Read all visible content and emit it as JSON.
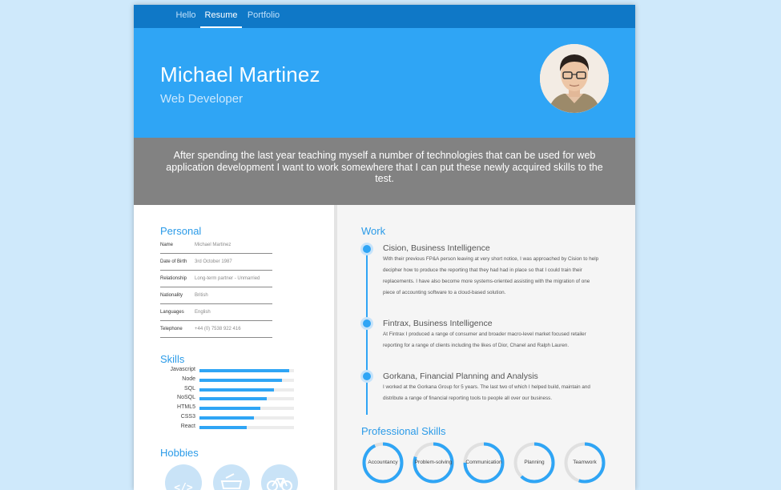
{
  "nav": {
    "items": [
      "Hello",
      "Resume",
      "Portfolio"
    ],
    "active": "Resume"
  },
  "header": {
    "name": "Michael Martinez",
    "role": "Web Developer"
  },
  "intro": "After spending the last year teaching myself a number of technologies that can be used for web application development I want to work somewhere that I can put these newly acquired skills to the test.",
  "personal": {
    "title": "Personal",
    "rows": [
      {
        "label": "Name",
        "value": "Michael Martinez"
      },
      {
        "label": "Date of Birth",
        "value": "3rd October 1987"
      },
      {
        "label": "Relationship",
        "value": "Long-term partner - Unmarried"
      },
      {
        "label": "Nationality",
        "value": "British"
      },
      {
        "label": "Languages",
        "value": "English"
      },
      {
        "label": "Telephone",
        "value": "+44 (0) 7538 922 416"
      }
    ]
  },
  "skills": {
    "title": "Skills",
    "items": [
      {
        "name": "Javascript",
        "level": 0.95
      },
      {
        "name": "Node",
        "level": 0.87
      },
      {
        "name": "SQL",
        "level": 0.79
      },
      {
        "name": "NoSQL",
        "level": 0.71
      },
      {
        "name": "HTML5",
        "level": 0.64
      },
      {
        "name": "CSS3",
        "level": 0.58
      },
      {
        "name": "React",
        "level": 0.5
      }
    ]
  },
  "hobbies": {
    "title": "Hobbies",
    "icons": [
      "code-icon",
      "food-icon",
      "bicycle-icon"
    ]
  },
  "work": {
    "title": "Work",
    "jobs": [
      {
        "title": "Cision, Business Intelligence",
        "desc": "With their previous FP&A person leaving at very short notice, I was approached by Cision to help decipher how to produce the reporting that they had had in place so that I could train their replacements. I have also become more systems-oriented assisting with the migration of one piece of accounting software to a cloud-based solution."
      },
      {
        "title": "Fintrax, Business Intelligence",
        "desc": "At Fintrax I produced a range of consumer and broader macro-level market focused retailer reporting for a range of clients including the likes of Dior, Chanel and Ralph Lauren."
      },
      {
        "title": "Gorkana, Financial Planning and Analysis",
        "desc": "I worked at the Gorkana Group for 5 years. The last two of which I helped build, maintain and distribute a range of financial reporting tools to people all over our business."
      }
    ]
  },
  "professional_skills": {
    "title": "Professional Skills",
    "items": [
      {
        "name": "Accountancy",
        "level": 0.93
      },
      {
        "name": "Problem-solving",
        "level": 0.8
      },
      {
        "name": "Communication",
        "level": 0.75
      },
      {
        "name": "Planning",
        "level": 0.62
      },
      {
        "name": "Teamwork",
        "level": 0.55
      }
    ]
  },
  "colors": {
    "accent": "#2fa5f5",
    "nav": "#0f78c7",
    "intro_bg": "#828282",
    "track": "#e0e0e0"
  }
}
